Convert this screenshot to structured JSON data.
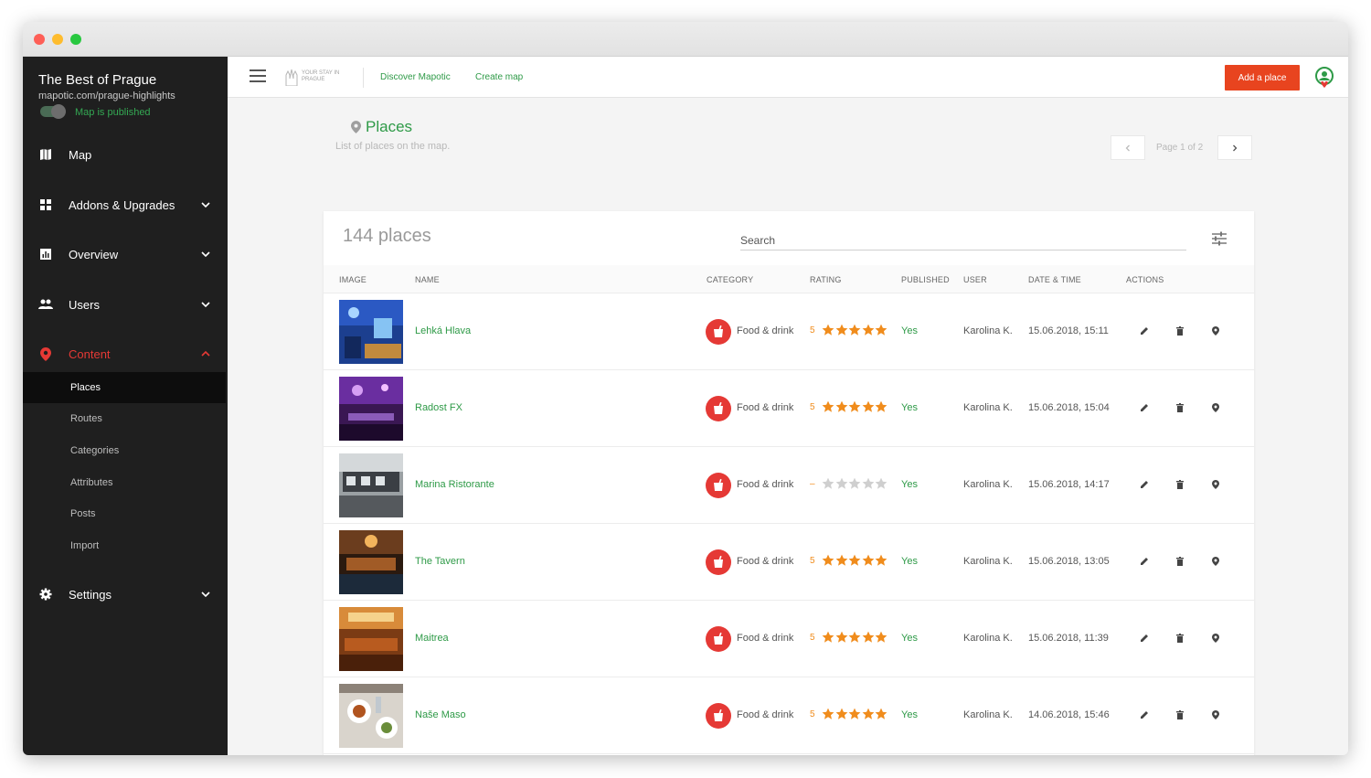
{
  "sidebar": {
    "map_title": "The Best of Prague",
    "map_url": "mapotic.com/prague-highlights",
    "published_label": "Map is published",
    "nav": [
      {
        "label": "Map",
        "icon": "map-icon"
      },
      {
        "label": "Addons & Upgrades",
        "icon": "addons-icon"
      },
      {
        "label": "Overview",
        "icon": "chart-icon"
      },
      {
        "label": "Users",
        "icon": "users-icon"
      },
      {
        "label": "Content",
        "icon": "pin-icon"
      },
      {
        "label": "Settings",
        "icon": "gear-icon"
      }
    ],
    "content_sub": [
      "Places",
      "Routes",
      "Categories",
      "Attributes",
      "Posts",
      "Import"
    ],
    "selected_sub": "Places"
  },
  "topbar": {
    "logo_text_1": "YOUR STAY IN",
    "logo_text_2": "PRAGUE",
    "discover_label": "Discover Mapotic",
    "create_label": "Create map",
    "add_place_label": "Add a place"
  },
  "page": {
    "title": "Places",
    "subtitle": "List of places on the map.",
    "pager_text": "Page 1 of 2"
  },
  "table": {
    "count_label": "144 places",
    "search_placeholder": "Search",
    "headers": {
      "image": "IMAGE",
      "name": "NAME",
      "category": "CATEGORY",
      "rating": "RATING",
      "published": "PUBLISHED",
      "user": "USER",
      "datetime": "DATE & TIME",
      "actions": "ACTIONS"
    },
    "rows": [
      {
        "name": "Lehká Hlava",
        "category": "Food & drink",
        "rating": "5",
        "stars": 5,
        "published": "Yes",
        "user": "Karolina K.",
        "datetime": "15.06.2018, 15:11",
        "thumb": "blue-interior"
      },
      {
        "name": "Radost FX",
        "category": "Food & drink",
        "rating": "5",
        "stars": 5,
        "published": "Yes",
        "user": "Karolina K.",
        "datetime": "15.06.2018, 15:04",
        "thumb": "purple-interior"
      },
      {
        "name": "Marina Ristorante",
        "category": "Food & drink",
        "rating": "–",
        "stars": 0,
        "published": "Yes",
        "user": "Karolina K.",
        "datetime": "15.06.2018, 14:17",
        "thumb": "boat-restaurant"
      },
      {
        "name": "The Tavern",
        "category": "Food & drink",
        "rating": "5",
        "stars": 5,
        "published": "Yes",
        "user": "Karolina K.",
        "datetime": "15.06.2018, 13:05",
        "thumb": "tavern-interior"
      },
      {
        "name": "Maitrea",
        "category": "Food & drink",
        "rating": "5",
        "stars": 5,
        "published": "Yes",
        "user": "Karolina K.",
        "datetime": "15.06.2018, 11:39",
        "thumb": "warm-interior"
      },
      {
        "name": "Naše Maso",
        "category": "Food & drink",
        "rating": "5",
        "stars": 5,
        "published": "Yes",
        "user": "Karolina K.",
        "datetime": "14.06.2018, 15:46",
        "thumb": "food-table"
      }
    ]
  },
  "colors": {
    "accent_green": "#2e9a47",
    "accent_red": "#e53935",
    "button_orange": "#e8441f",
    "star_orange": "#f08c1c",
    "sidebar_bg": "#1f1f1f"
  }
}
